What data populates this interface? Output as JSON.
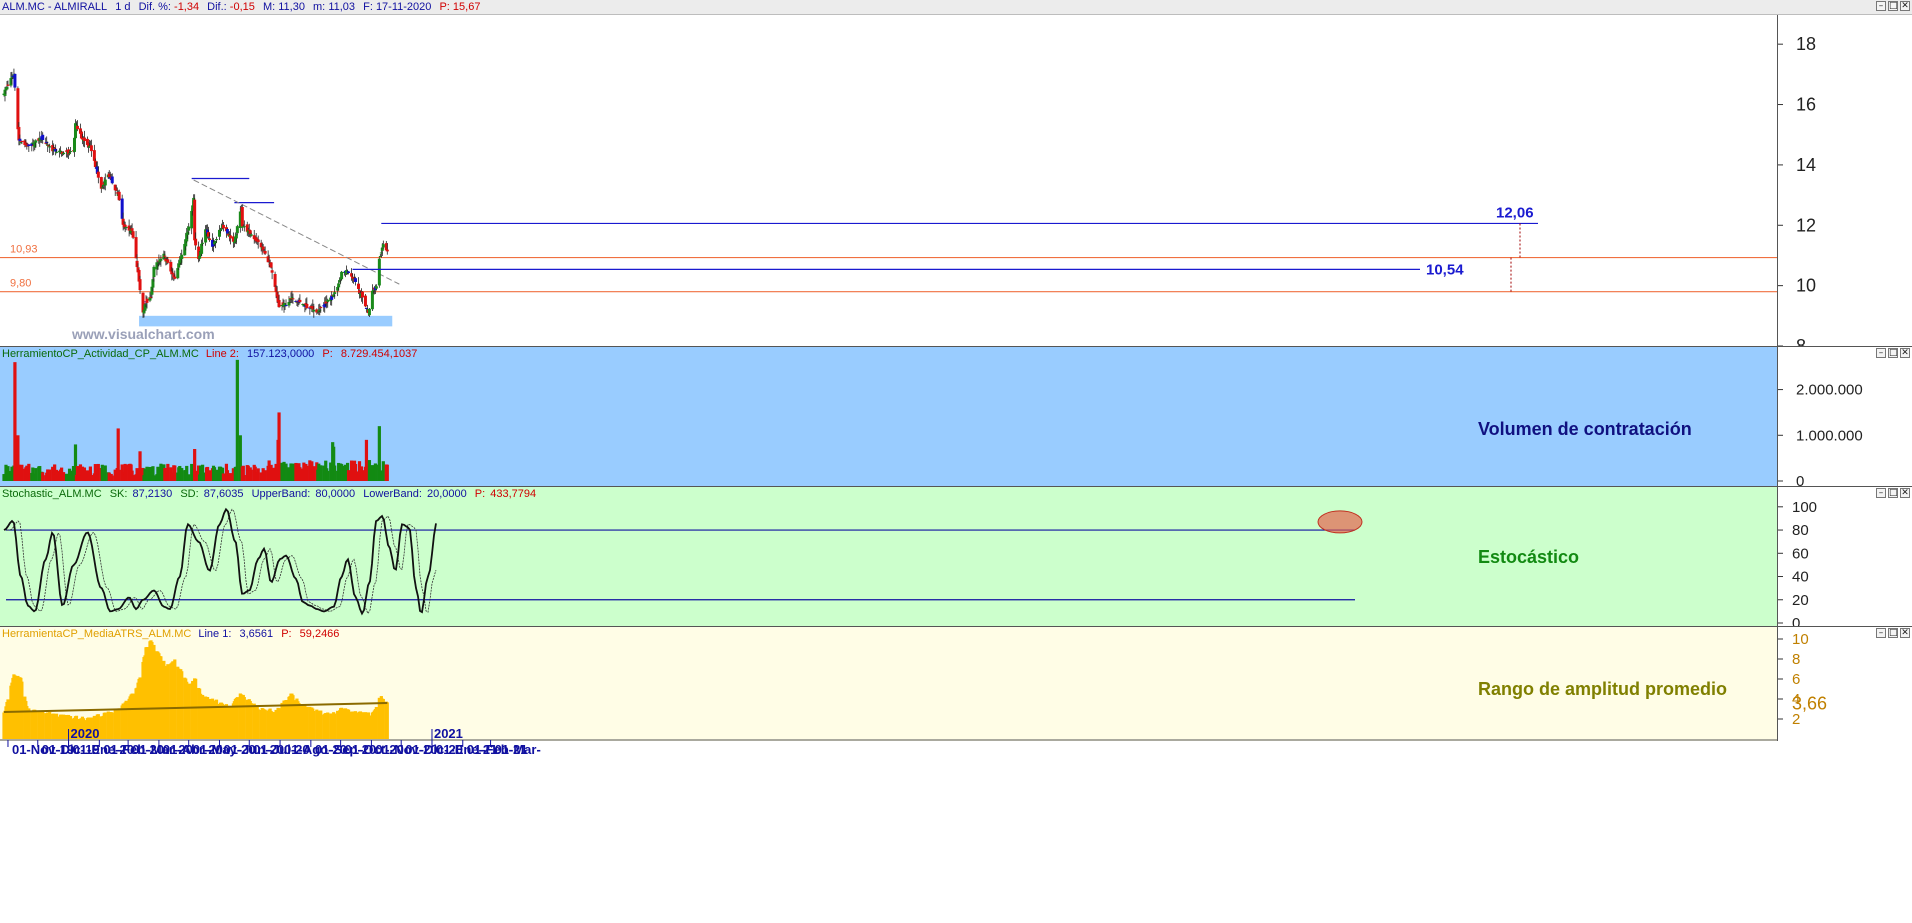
{
  "header": {
    "symbol": "ALM.MC - ALMIRALL",
    "interval": "1 d",
    "dif_pct_label": "Dif. %:",
    "dif_pct": "-1,34",
    "dif_label": "Dif.:",
    "dif": "-0,15",
    "max_label": "M:",
    "max": "11,30",
    "min_label": "m:",
    "min": "11,03",
    "date_label": "F:",
    "date": "17-11-2020",
    "p_label": "P:",
    "p": "15,67"
  },
  "watermark": "www.visualchart.com",
  "window_buttons": [
    "–",
    "□",
    "✕"
  ],
  "colors": {
    "up": "#1a8a1a",
    "down": "#e01010",
    "inside": "#1010cc",
    "volume_bg": "#99ccff",
    "stoch_bg": "#ccffcc",
    "atr_bg": "#fffde6",
    "atr_bar": "#ffc000",
    "level_line": "#f07040",
    "blue_line": "#1a1ad0",
    "support_zone": "#99ccff",
    "title_blue": "#101080",
    "title_green": "#128a12",
    "title_olive": "#808000"
  },
  "chart_data": [
    {
      "id": "price",
      "type": "candlestick",
      "x_axis_labels": [
        "01-Nov-19",
        "01-Dic-19",
        "01-Ene-20",
        "01-Feb-20",
        "01-Mar-20",
        "01-Abr-20",
        "01-May-20",
        "01-Jun-20",
        "01-Jul-20",
        "01-Ago-20",
        "01-Sep-20",
        "01-Oct-20",
        "01-Nov-20",
        "01-Dic-20",
        "01-Ene-21",
        "01-Feb-21",
        "01-Mar-"
      ],
      "year_markers": [
        "2020",
        "2021"
      ],
      "ylim": [
        8,
        19
      ],
      "y_ticks": [
        8,
        10,
        12,
        14,
        16,
        18
      ],
      "levels": [
        {
          "value": 10.93,
          "label": "10,93"
        },
        {
          "value": 9.8,
          "label": "9,80"
        }
      ],
      "targets": [
        {
          "value": 12.06,
          "label": "12,06"
        },
        {
          "value": 10.54,
          "label": "10,54"
        }
      ],
      "resistance_segments": [
        {
          "value": 13.55,
          "from": "2020-05-04",
          "to": "2020-07-01"
        },
        {
          "value": 12.75,
          "from": "2020-06-16",
          "to": "2020-07-26"
        }
      ],
      "trendline": {
        "from": {
          "date": "2020-05-06",
          "value": 13.5
        },
        "to": {
          "date": "2020-11-17",
          "value": 10.15
        }
      },
      "support_zone": {
        "from": "2020-03-12",
        "to": "2020-11-22",
        "low": 8.65,
        "high": 9.0
      },
      "close_anchors": [
        [
          "2019-10-28",
          16.4
        ],
        [
          "2019-11-05",
          16.9
        ],
        [
          "2019-11-07",
          17.0
        ],
        [
          "2019-11-12",
          14.8
        ],
        [
          "2019-11-22",
          14.6
        ],
        [
          "2019-12-05",
          14.9
        ],
        [
          "2019-12-16",
          14.5
        ],
        [
          "2019-12-27",
          14.4
        ],
        [
          "2020-01-06",
          14.4
        ],
        [
          "2020-01-08",
          15.4
        ],
        [
          "2020-01-14",
          14.9
        ],
        [
          "2020-01-24",
          14.5
        ],
        [
          "2020-02-03",
          13.2
        ],
        [
          "2020-02-10",
          13.7
        ],
        [
          "2020-02-20",
          13.0
        ],
        [
          "2020-02-25",
          12.0
        ],
        [
          "2020-03-05",
          11.8
        ],
        [
          "2020-03-11",
          10.4
        ],
        [
          "2020-03-16",
          9.1
        ],
        [
          "2020-03-18",
          9.4
        ],
        [
          "2020-03-24",
          9.6
        ],
        [
          "2020-03-27",
          10.6
        ],
        [
          "2020-04-06",
          11.0
        ],
        [
          "2020-04-17",
          10.2
        ],
        [
          "2020-04-30",
          11.8
        ],
        [
          "2020-05-06",
          12.9
        ],
        [
          "2020-05-07",
          11.5
        ],
        [
          "2020-05-11",
          10.9
        ],
        [
          "2020-05-18",
          11.9
        ],
        [
          "2020-05-25",
          11.3
        ],
        [
          "2020-06-04",
          12.0
        ],
        [
          "2020-06-16",
          11.4
        ],
        [
          "2020-06-23",
          12.6
        ],
        [
          "2020-06-24",
          12.0
        ],
        [
          "2020-07-03",
          11.7
        ],
        [
          "2020-07-13",
          11.3
        ],
        [
          "2020-07-22",
          10.7
        ],
        [
          "2020-07-31",
          9.3
        ],
        [
          "2020-08-07",
          9.4
        ],
        [
          "2020-08-14",
          9.6
        ],
        [
          "2020-08-28",
          9.3
        ],
        [
          "2020-09-07",
          9.1
        ],
        [
          "2020-09-21",
          9.6
        ],
        [
          "2020-09-28",
          9.9
        ],
        [
          "2020-10-02",
          10.4
        ],
        [
          "2020-10-08",
          10.5
        ],
        [
          "2020-10-15",
          10.2
        ],
        [
          "2020-10-23",
          9.6
        ],
        [
          "2020-10-29",
          9.1
        ],
        [
          "2020-11-02",
          9.8
        ],
        [
          "2020-11-06",
          10.0
        ],
        [
          "2020-11-09",
          10.9
        ],
        [
          "2020-11-13",
          11.4
        ],
        [
          "2020-11-17",
          11.1
        ]
      ]
    },
    {
      "id": "volume",
      "type": "bar",
      "title": "Volumen de contratación",
      "header": {
        "name": "HerramientoCP_Actividad_CP_ALM.MC",
        "line_label": "Line 2:",
        "line_value": "157.123,0000",
        "p_label": "P:",
        "p_value": "8.729.454,1037"
      },
      "ylim": [
        0,
        2800000
      ],
      "y_tick_labels": [
        {
          "v": 2000000,
          "t": "2.000.000"
        },
        {
          "v": 1000000,
          "t": "1.000.000"
        },
        {
          "v": 0,
          "t": "0"
        }
      ],
      "spikes": [
        {
          "date": "2019-11-08",
          "value": 2600000
        },
        {
          "date": "2019-11-11",
          "value": 1000000
        },
        {
          "date": "2020-01-08",
          "value": 800000
        },
        {
          "date": "2020-02-20",
          "value": 1150000
        },
        {
          "date": "2020-03-13",
          "value": 650000
        },
        {
          "date": "2020-05-07",
          "value": 700000
        },
        {
          "date": "2020-06-19",
          "value": 2650000
        },
        {
          "date": "2020-06-22",
          "value": 1000000
        },
        {
          "date": "2020-07-31",
          "value": 1500000
        },
        {
          "date": "2020-07-30",
          "value": 900000
        },
        {
          "date": "2020-09-23",
          "value": 850000
        },
        {
          "date": "2020-09-24",
          "value": 750000
        },
        {
          "date": "2020-10-27",
          "value": 900000
        },
        {
          "date": "2020-11-09",
          "value": 1200000
        }
      ]
    },
    {
      "id": "stochastic",
      "type": "line",
      "title": "Estocástico",
      "header": {
        "name": "Stochastic_ALM.MC",
        "sk_label": "SK:",
        "sk": "87,2130",
        "sd_label": "SD:",
        "sd": "87,6035",
        "ub_label": "UpperBand:",
        "ub": "80,0000",
        "lb_label": "LowerBand:",
        "lb": "20,0000",
        "p_label": "P:",
        "p": "433,7794"
      },
      "ylim": [
        0,
        105
      ],
      "y_ticks": [
        0,
        20,
        40,
        60,
        80,
        100
      ],
      "bands": [
        80,
        20
      ],
      "series": [
        {
          "name": "SK",
          "anchors": [
            [
              "2019-10-28",
              80
            ],
            [
              "2019-11-06",
              88
            ],
            [
              "2019-11-14",
              40
            ],
            [
              "2019-11-21",
              15
            ],
            [
              "2019-11-28",
              10
            ],
            [
              "2019-12-09",
              55
            ],
            [
              "2019-12-16",
              78
            ],
            [
              "2019-12-26",
              15
            ],
            [
              "2020-01-06",
              50
            ],
            [
              "2020-01-20",
              78
            ],
            [
              "2020-02-03",
              30
            ],
            [
              "2020-02-12",
              10
            ],
            [
              "2020-02-20",
              12
            ],
            [
              "2020-03-02",
              22
            ],
            [
              "2020-03-09",
              12
            ],
            [
              "2020-03-16",
              20
            ],
            [
              "2020-03-27",
              28
            ],
            [
              "2020-04-06",
              14
            ],
            [
              "2020-04-12",
              12
            ],
            [
              "2020-04-22",
              40
            ],
            [
              "2020-04-30",
              85
            ],
            [
              "2020-05-11",
              70
            ],
            [
              "2020-05-22",
              45
            ],
            [
              "2020-06-01",
              85
            ],
            [
              "2020-06-08",
              98
            ],
            [
              "2020-06-17",
              70
            ],
            [
              "2020-06-24",
              25
            ],
            [
              "2020-07-01",
              28
            ],
            [
              "2020-07-10",
              55
            ],
            [
              "2020-07-16",
              64
            ],
            [
              "2020-07-23",
              35
            ],
            [
              "2020-08-01",
              55
            ],
            [
              "2020-08-07",
              58
            ],
            [
              "2020-08-17",
              38
            ],
            [
              "2020-08-24",
              18
            ],
            [
              "2020-08-31",
              15
            ],
            [
              "2020-09-07",
              12
            ],
            [
              "2020-09-14",
              10
            ],
            [
              "2020-09-24",
              14
            ],
            [
              "2020-10-02",
              40
            ],
            [
              "2020-10-08",
              55
            ],
            [
              "2020-10-16",
              22
            ],
            [
              "2020-10-23",
              8
            ],
            [
              "2020-10-30",
              35
            ],
            [
              "2020-11-06",
              88
            ],
            [
              "2020-11-12",
              92
            ],
            [
              "2020-11-19",
              65
            ],
            [
              "2020-11-25",
              45
            ],
            [
              "2020-12-02",
              85
            ],
            [
              "2020-12-09",
              82
            ],
            [
              "2020-12-16",
              30
            ],
            [
              "2020-12-21",
              8
            ],
            [
              "2020-12-28",
              40
            ],
            [
              "2021-01-06",
              87
            ]
          ]
        }
      ]
    },
    {
      "id": "atr",
      "type": "bar",
      "title": "Rango de amplitud promedio",
      "header": {
        "name": "HerramientaCP_MediaATRS_ALM.MC",
        "line_label": "Line 1:",
        "line_value": "3,6561",
        "p_label": "P:",
        "p_value": "59,2466"
      },
      "ylim": [
        0,
        10
      ],
      "y_ticks": [
        2,
        4,
        6,
        8,
        10
      ],
      "current_value_label": "3,66",
      "avg_line": [
        [
          "2019-10-28",
          2.7
        ],
        [
          "2020-11-17",
          3.6
        ]
      ],
      "anchors": [
        [
          "2019-10-28",
          2.5
        ],
        [
          "2019-11-07",
          6.5
        ],
        [
          "2019-11-14",
          6.0
        ],
        [
          "2019-11-21",
          3.0
        ],
        [
          "2019-12-09",
          2.6
        ],
        [
          "2019-12-27",
          2.3
        ],
        [
          "2020-01-06",
          2.2
        ],
        [
          "2020-01-20",
          2.0
        ],
        [
          "2020-02-03",
          2.4
        ],
        [
          "2020-02-20",
          3.0
        ],
        [
          "2020-02-26",
          3.5
        ],
        [
          "2020-03-09",
          5.0
        ],
        [
          "2020-03-13",
          6.2
        ],
        [
          "2020-03-19",
          9.0
        ],
        [
          "2020-03-24",
          9.8
        ],
        [
          "2020-04-01",
          8.5
        ],
        [
          "2020-04-08",
          7.3
        ],
        [
          "2020-04-17",
          7.8
        ],
        [
          "2020-05-01",
          5.5
        ],
        [
          "2020-05-08",
          6.0
        ],
        [
          "2020-05-14",
          4.4
        ],
        [
          "2020-06-12",
          3.2
        ],
        [
          "2020-06-23",
          4.6
        ],
        [
          "2020-07-10",
          3.1
        ],
        [
          "2020-07-28",
          2.8
        ],
        [
          "2020-08-12",
          4.5
        ],
        [
          "2020-08-26",
          3.2
        ],
        [
          "2020-09-21",
          2.4
        ],
        [
          "2020-10-02",
          3.0
        ],
        [
          "2020-10-20",
          2.6
        ],
        [
          "2020-11-02",
          2.5
        ],
        [
          "2020-11-10",
          4.2
        ],
        [
          "2020-11-17",
          3.66
        ]
      ]
    }
  ]
}
